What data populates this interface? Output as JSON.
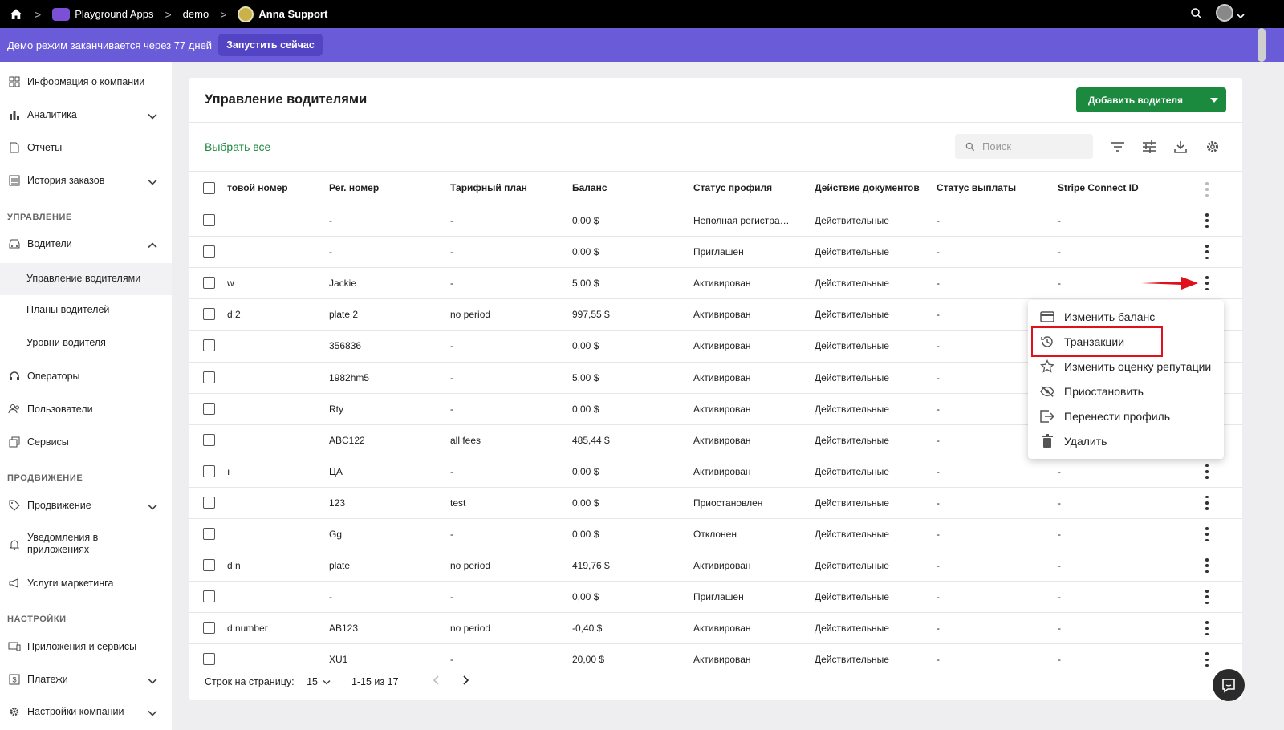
{
  "topbar": {
    "org": "Playground Apps",
    "project": "demo",
    "app": "Anna Support"
  },
  "demo_banner": {
    "text": "Демо режим заканчивается через 77 дней",
    "button": "Запустить сейчас"
  },
  "sidebar": {
    "items": [
      {
        "label": "Информация о компании",
        "icon": "grid-icon"
      },
      {
        "label": "Аналитика",
        "icon": "bar-chart-icon"
      },
      {
        "label": "Отчеты",
        "icon": "document-icon"
      },
      {
        "label": "История заказов",
        "icon": "list-icon"
      }
    ],
    "section_manage": "УПРАВЛЕНИЕ",
    "drivers": "Водители",
    "drivers_sub": [
      "Управление водителями",
      "Планы водителей",
      "Уровни водителя"
    ],
    "operators": "Операторы",
    "users": "Пользователи",
    "services": "Сервисы",
    "section_promo": "ПРОДВИЖЕНИЕ",
    "promotion": "Продвижение",
    "notifications": "Уведомления в приложениях",
    "marketing": "Услуги маркетинга",
    "section_settings": "НАСТРОЙКИ",
    "apps": "Приложения и сервисы",
    "payments": "Платежи",
    "company_settings": "Настройки компании"
  },
  "page": {
    "title": "Управление водителями",
    "add_button": "Добавить водителя",
    "select_all": "Выбрать все",
    "search_placeholder": "Поиск"
  },
  "table": {
    "columns": [
      "товой номер",
      "Рег. номер",
      "Тарифный план",
      "Баланс",
      "Статус профиля",
      "Действие документов",
      "Статус выплаты",
      "Stripe Connect ID"
    ],
    "rows": [
      [
        "",
        "-",
        "-",
        "0,00 $",
        "Неполная регистра…",
        "Действительные",
        "-",
        "-"
      ],
      [
        "",
        "-",
        "-",
        "0,00 $",
        "Приглашен",
        "Действительные",
        "-",
        "-"
      ],
      [
        "w",
        "Jackie",
        "-",
        "5,00 $",
        "Активирован",
        "Действительные",
        "-",
        "-"
      ],
      [
        "d 2",
        "plate 2",
        "no period",
        "997,55 $",
        "Активирован",
        "Действительные",
        "-",
        ""
      ],
      [
        "",
        "356836",
        "-",
        "0,00 $",
        "Активирован",
        "Действительные",
        "-",
        ""
      ],
      [
        "",
        "1982hm5",
        "-",
        "5,00 $",
        "Активирован",
        "Действительные",
        "-",
        ""
      ],
      [
        "",
        "Rty",
        "-",
        "0,00 $",
        "Активирован",
        "Действительные",
        "-",
        ""
      ],
      [
        "",
        "ABC122",
        "all fees",
        "485,44 $",
        "Активирован",
        "Действительные",
        "-",
        ""
      ],
      [
        "ı",
        "ЦА",
        "-",
        "0,00 $",
        "Активирован",
        "Действительные",
        "-",
        "-"
      ],
      [
        "",
        "123",
        "test",
        "0,00 $",
        "Приостановлен",
        "Действительные",
        "-",
        "-"
      ],
      [
        "",
        "Gg",
        "-",
        "0,00 $",
        "Отклонен",
        "Действительные",
        "-",
        "-"
      ],
      [
        "d n",
        "plate",
        "no period",
        "419,76 $",
        "Активирован",
        "Действительные",
        "-",
        "-"
      ],
      [
        "",
        "-",
        "-",
        "0,00 $",
        "Приглашен",
        "Действительные",
        "-",
        "-"
      ],
      [
        "d number",
        "AB123",
        "no period",
        "-0,40 $",
        "Активирован",
        "Действительные",
        "-",
        "-"
      ],
      [
        "",
        "XU1",
        "-",
        "20,00 $",
        "Активирован",
        "Действительные",
        "-",
        "-"
      ]
    ]
  },
  "footer": {
    "rows_per_page_label": "Строк на страницу:",
    "rows_per_page": "15",
    "range": "1-15 из 17"
  },
  "context_menu": {
    "items": [
      {
        "label": "Изменить баланс",
        "icon": "card-icon"
      },
      {
        "label": "Транзакции",
        "icon": "history-icon"
      },
      {
        "label": "Изменить оценку репутации",
        "icon": "star-icon"
      },
      {
        "label": "Приостановить",
        "icon": "eye-off-icon"
      },
      {
        "label": "Перенести профиль",
        "icon": "transfer-icon"
      },
      {
        "label": "Удалить",
        "icon": "trash-icon"
      }
    ]
  },
  "colors": {
    "topbar": "#000000",
    "banner": "#6a5cd8",
    "accent_green": "#1b8a3e",
    "highlight_red": "#e0111b"
  }
}
